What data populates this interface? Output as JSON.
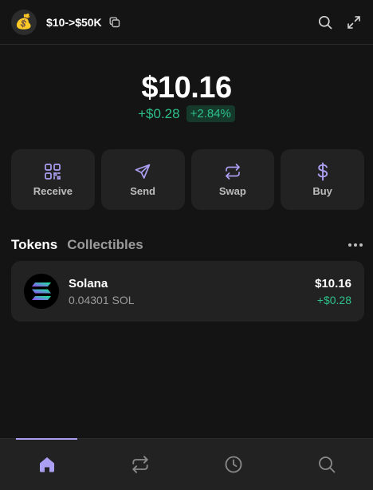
{
  "header": {
    "avatar_emoji": "💰",
    "account_name": "$10->$50K",
    "icons": [
      "copy-icon",
      "search-icon",
      "expand-icon"
    ]
  },
  "balance": {
    "total": "$10.16",
    "change_usd": "+$0.28",
    "change_pct": "+2.84%"
  },
  "actions": [
    {
      "label": "Receive",
      "icon": "qr-code-icon"
    },
    {
      "label": "Send",
      "icon": "send-icon"
    },
    {
      "label": "Swap",
      "icon": "swap-icon"
    },
    {
      "label": "Buy",
      "icon": "dollar-icon"
    }
  ],
  "tabs": {
    "tokens": "Tokens",
    "collectibles": "Collectibles",
    "active": "Tokens"
  },
  "tokens": [
    {
      "name": "Solana",
      "amount": "0.04301 SOL",
      "usd": "$10.16",
      "change": "+$0.28"
    }
  ],
  "nav": {
    "items": [
      "home-icon",
      "swap-icon",
      "history-icon",
      "search-icon"
    ],
    "active": "home-icon"
  },
  "colors": {
    "background": "#141414",
    "card": "#222222",
    "accent": "#ab9ff2",
    "positive": "#2ec08b",
    "muted": "#9b9b9b"
  }
}
